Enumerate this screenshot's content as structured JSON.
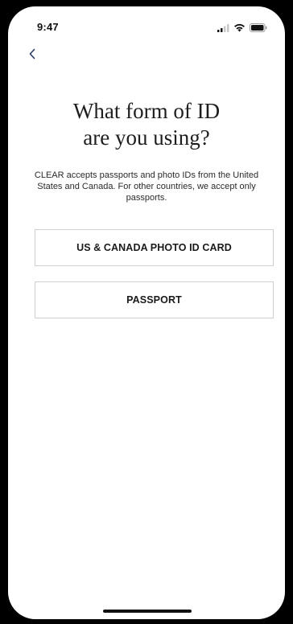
{
  "status_bar": {
    "time": "9:47",
    "icons": [
      "signal-icon",
      "wifi-icon",
      "battery-icon"
    ]
  },
  "nav": {
    "back_icon": "chevron-left-icon",
    "accent_color": "#2b3a67"
  },
  "main": {
    "title_line1": "What form of ID",
    "title_line2": "are you using?",
    "description": "CLEAR accepts passports and photo IDs from the United States and Canada. For other countries, we accept only passports.",
    "options": [
      {
        "label": "US & CANADA PHOTO ID CARD"
      },
      {
        "label": "PASSPORT"
      }
    ]
  }
}
